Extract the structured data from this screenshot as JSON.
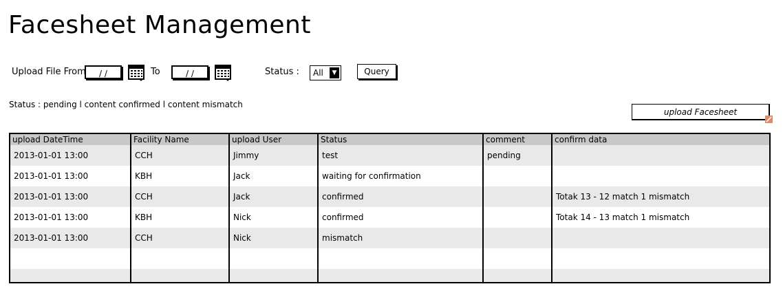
{
  "page": {
    "title": "Facesheet Management"
  },
  "filters": {
    "upload_from_label": "Upload File From",
    "from_value": "/ /",
    "to_label": "To",
    "to_value": "/ /",
    "status_label": "Status :",
    "status_selected": "All",
    "query_button": "Query"
  },
  "legend": "Status : pending l content confirmed l content mismatch",
  "upload_button": "upload Facesheet",
  "table": {
    "columns": [
      "upload DateTime",
      "Facility Name",
      "upload User",
      "Status",
      "comment",
      "confirm data"
    ],
    "rows": [
      [
        "2013-01-01 13:00",
        "CCH",
        "Jimmy",
        "test",
        "pending",
        ""
      ],
      [
        "2013-01-01 13:00",
        "KBH",
        "Jack",
        "waiting for confirmation",
        "",
        ""
      ],
      [
        "2013-01-01 13:00",
        "CCH",
        "Jack",
        "confirmed",
        "",
        "Totak 13 - 12 match 1 mismatch"
      ],
      [
        "2013-01-01 13:00",
        "KBH",
        "Nick",
        "confirmed",
        "",
        "Totak 14 - 13 match 1 mismatch"
      ],
      [
        "2013-01-01 13:00",
        "CCH",
        "Nick",
        "mismatch",
        "",
        ""
      ],
      [
        "",
        "",
        "",
        "",
        "",
        ""
      ],
      [
        "",
        "",
        "",
        "",
        "",
        ""
      ]
    ]
  },
  "icons": {
    "calendar": "calendar-icon",
    "dropdown": "chevron-down-icon",
    "resize": "resize-corner-icon"
  }
}
